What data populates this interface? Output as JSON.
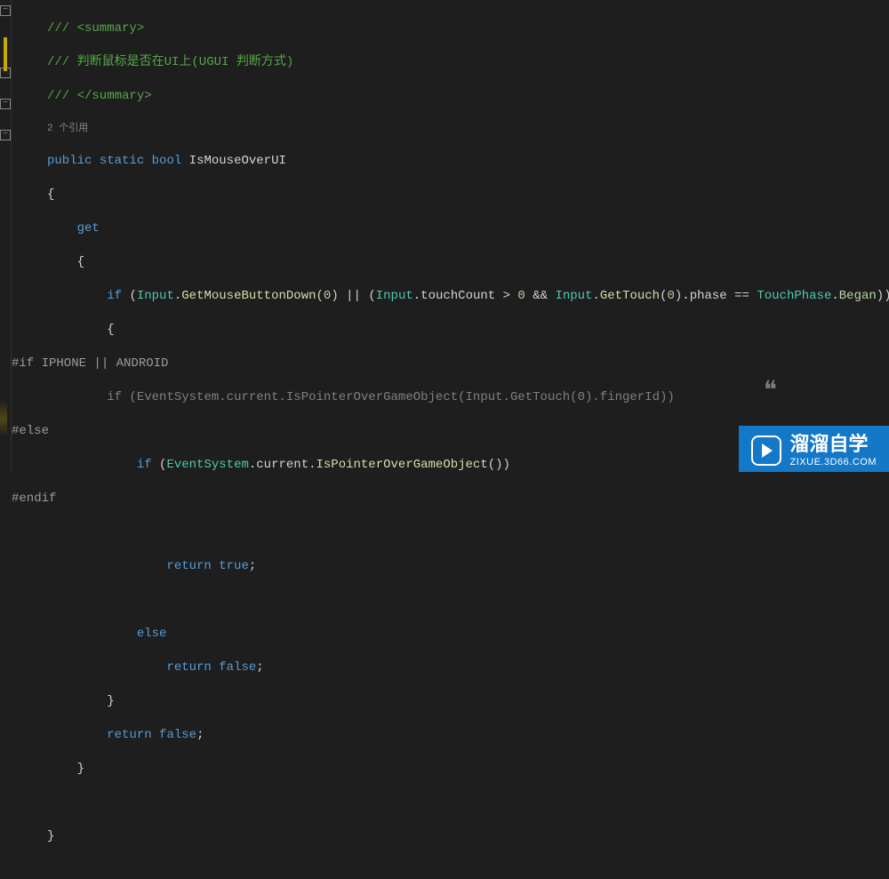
{
  "code": {
    "c1": "/// <summary>",
    "c2": "/// 判断鼠标是否在UI上(UGUI 判断方式)",
    "c3": "/// </summary>",
    "codelens": "2 个引用",
    "kw_public": "public",
    "kw_static": "static",
    "kw_bool": "bool",
    "prop_name": "IsMouseOverUI",
    "brace_open": "{",
    "brace_close": "}",
    "kw_get": "get",
    "kw_if": "if",
    "kw_else": "else",
    "kw_return": "return",
    "kw_true": "true",
    "kw_false": "false",
    "cls_input": "Input",
    "m_getmousebtndown": "GetMouseButtonDown",
    "m_gettouch": "GetTouch",
    "p_touchcount": "touchCount",
    "p_phase": "phase",
    "cls_touchphase": "TouchPhase",
    "enum_began": "Began",
    "num_zero": "0",
    "preproc_if": "#if IPHONE || ANDROID",
    "preproc_else": "#else",
    "preproc_endif": "#endif",
    "cls_eventsystem": "EventSystem",
    "p_current": "current",
    "m_ispointerover": "IsPointerOverGameObject",
    "p_fingerid": "fingerId",
    "semi": ";",
    "op_or": "||",
    "op_and": "&&",
    "op_gt": ">",
    "op_eq": "==",
    "dot": ".",
    "lparen": "(",
    "rparen": ")"
  },
  "watermark": {
    "title": "溜溜自学",
    "sub": "ZIXUE.3D66.COM"
  }
}
